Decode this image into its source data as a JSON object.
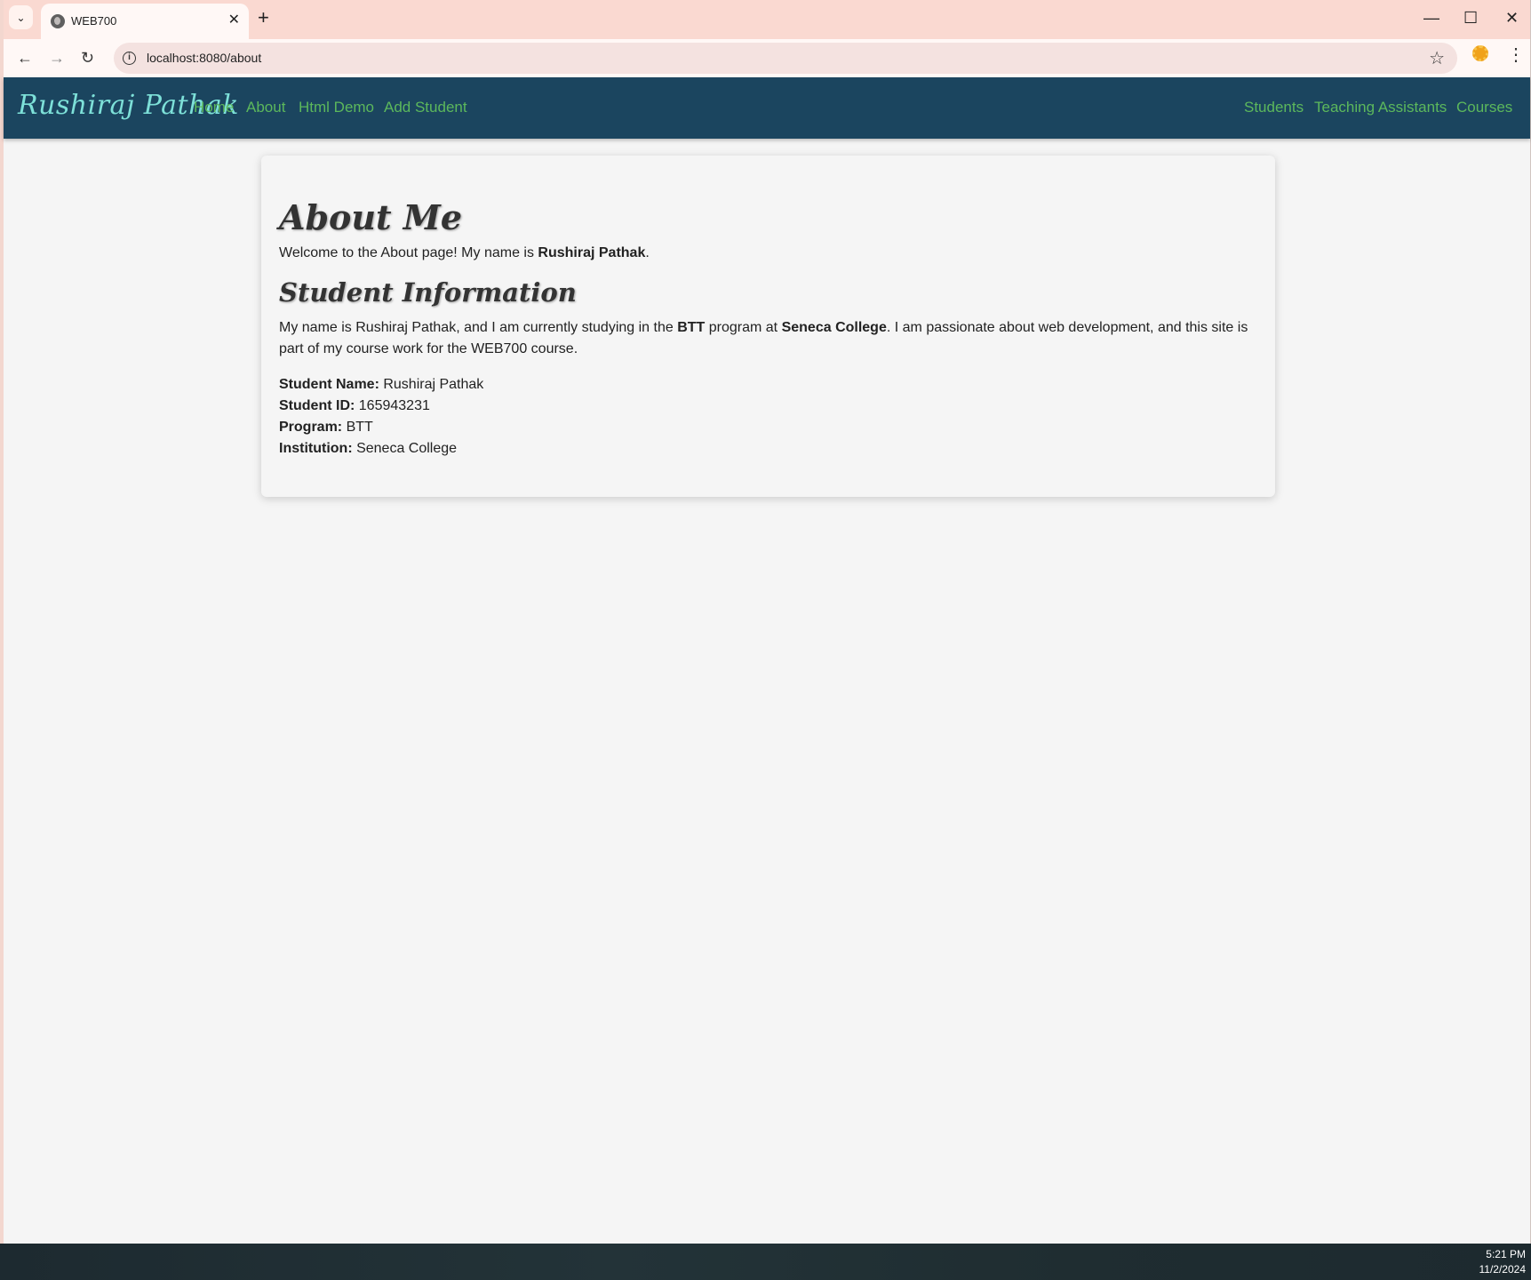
{
  "browser": {
    "tab_title": "WEB700",
    "url": "localhost:8080/about",
    "new_tab_symbol": "+",
    "tab_close_symbol": "✕",
    "minimize_symbol": "—",
    "maximize_symbol": "☐",
    "close_symbol": "✕",
    "back_symbol": "←",
    "forward_symbol": "→",
    "reload_symbol": "↻",
    "star_symbol": "☆",
    "menu_symbol": "⋮",
    "tab_menu_symbol": "⌄",
    "info_symbol": "i"
  },
  "nav": {
    "brand": "Rushiraj Pathak",
    "left_links": [
      "Home",
      "About",
      "Html Demo",
      "Add Student"
    ],
    "right_links": [
      "Students",
      "Teaching Assistants",
      "Courses"
    ]
  },
  "content": {
    "heading": "About Me",
    "welcome_prefix": "Welcome to the About page! My name is ",
    "welcome_name": "Rushiraj Pathak",
    "welcome_suffix": ".",
    "subheading": "Student Information",
    "info_part1": "My name is Rushiraj Pathak, and I am currently studying in the ",
    "info_program": "BTT",
    "info_part2": " program at ",
    "info_college": "Seneca College",
    "info_part3": ". I am passionate about web development, and this site is part of my course work for the WEB700 course.",
    "details": [
      {
        "label": "Student Name:",
        "value": " Rushiraj Pathak"
      },
      {
        "label": "Student ID:",
        "value": " 165943231"
      },
      {
        "label": "Program:",
        "value": " BTT"
      },
      {
        "label": "Institution:",
        "value": " Seneca College"
      }
    ]
  },
  "taskbar": {
    "time": "5:21 PM",
    "date": "11/2/2024"
  },
  "colors": {
    "nav_bg": "#1b455f",
    "brand": "#7de0d8",
    "link": "#5cb85c",
    "tabstrip": "#fad9d1"
  }
}
